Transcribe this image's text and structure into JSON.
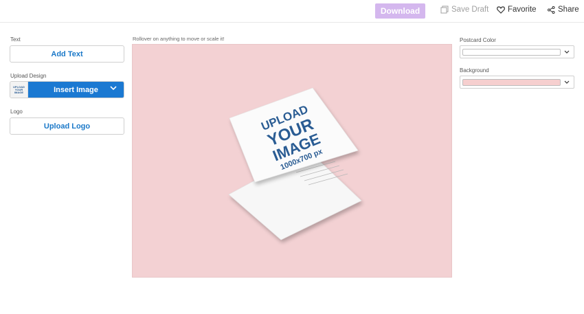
{
  "topbar": {
    "download_label": "Download",
    "save_draft_label": "Save Draft",
    "favorite_label": "Favorite",
    "share_label": "Share"
  },
  "left_panel": {
    "text_label": "Text",
    "add_text_button": "Add Text",
    "upload_design_label": "Upload Design",
    "upload_thumb_lines": [
      "UPLOAD",
      "YOUR",
      "IMAGE"
    ],
    "insert_image_button": "Insert Image",
    "logo_label": "Logo",
    "upload_logo_button": "Upload Logo"
  },
  "canvas": {
    "hint": "Rollover on anything to move or scale it!",
    "card_text": {
      "line1": "UPLOAD",
      "line2": "YOUR",
      "line3": "IMAGE",
      "line4": "1000x700 px"
    }
  },
  "right_panel": {
    "postcard_color_label": "Postcard Color",
    "postcard_color_value": "#ffffff",
    "background_label": "Background",
    "background_value": "#f6cfcf"
  },
  "colors": {
    "accent": "#1b79d2",
    "download_disabled": "#d4b7ee",
    "canvas_bg": "#f3d1d3",
    "placeholder_text": "#2a5c93"
  },
  "icons": {
    "save_draft": "copy-icon",
    "favorite": "heart-icon",
    "share": "share-icon",
    "dropdown": "chevron-down-icon"
  }
}
